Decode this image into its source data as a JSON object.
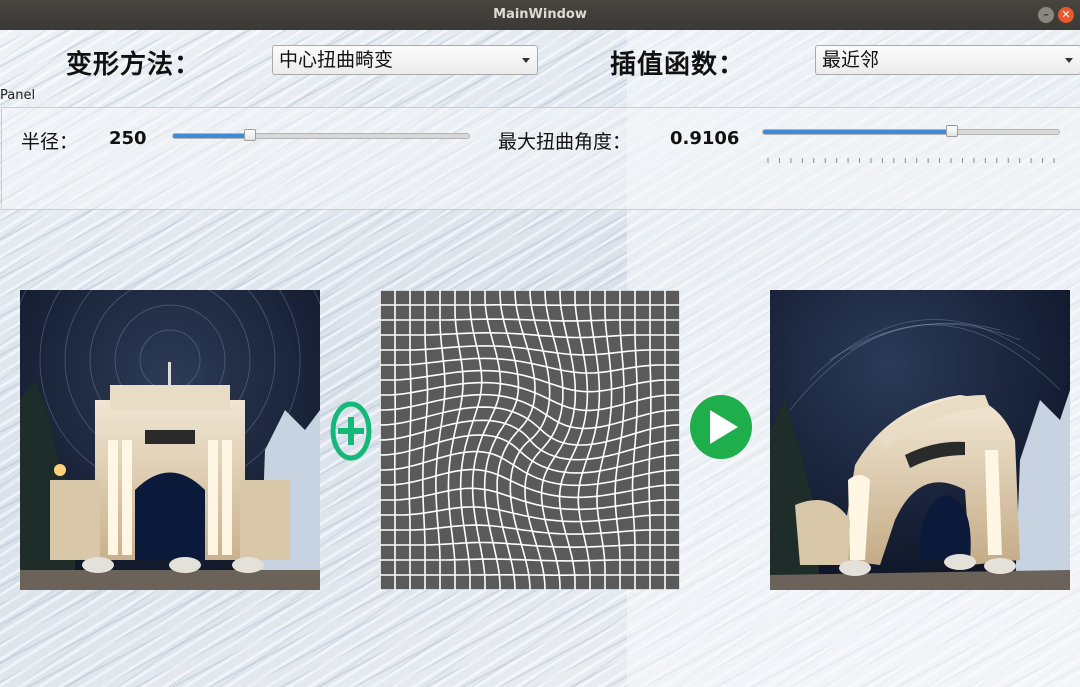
{
  "window": {
    "title": "MainWindow"
  },
  "controls": {
    "method_label": "变形方法：",
    "method_value": "中心扭曲畸变",
    "interp_label": "插值函数：",
    "interp_value": "最近邻"
  },
  "panel": {
    "title": "Panel",
    "radius_label": "半径：",
    "radius_value": "250",
    "radius_fraction": 0.26,
    "angle_label": "最大扭曲角度：",
    "angle_value": "0.9106",
    "angle_fraction": 0.64
  },
  "images": {
    "source": "source-photo (Tsinghua second gate at night, star trails)",
    "grid": "warped-grid",
    "result": "distorted-result-photo"
  },
  "icons": {
    "plus": "plus-circle-icon",
    "play": "play-icon"
  },
  "colors": {
    "plus": "#14b879",
    "play": "#1fae4c",
    "slider_fill": "#3c8dd6",
    "grid_bg": "#5a5a5a"
  }
}
